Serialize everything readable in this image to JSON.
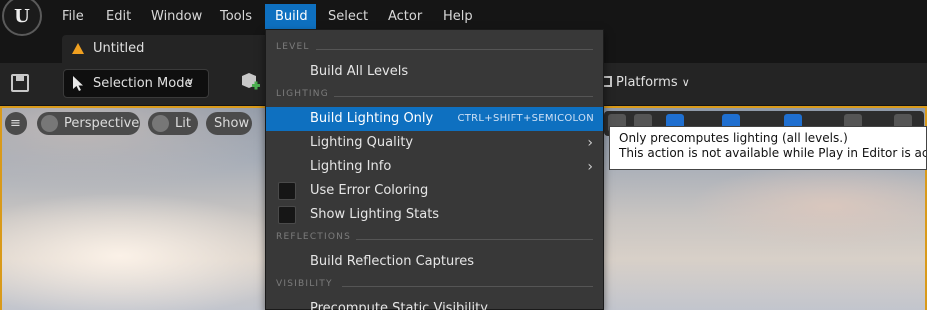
{
  "menubar": {
    "logo_text": "U",
    "items": [
      "File",
      "Edit",
      "Window",
      "Tools",
      "Build",
      "Select",
      "Actor",
      "Help"
    ],
    "active_item": "Build",
    "accent_color": "#0e70c0"
  },
  "tab": {
    "title": "Untitled",
    "icon": "unreal-warning-icon"
  },
  "toolbar": {
    "selection_mode_label": "Selection Mode",
    "platforms_label": "Platforms"
  },
  "viewport": {
    "menu_icon": "hamburger-icon",
    "perspective_label": "Perspective",
    "lit_label": "Lit",
    "show_label": "Show"
  },
  "build_menu": {
    "sections": {
      "level": "LEVEL",
      "lighting": "LIGHTING",
      "reflections": "REFLECTIONS",
      "visibility": "VISIBILITY"
    },
    "items": {
      "build_all_levels": "Build All Levels",
      "build_lighting_only": "Build Lighting Only",
      "build_lighting_only_shortcut": "CTRL+SHIFT+SEMICOLON",
      "lighting_quality": "Lighting Quality",
      "lighting_info": "Lighting Info",
      "use_error_coloring": "Use Error Coloring",
      "show_lighting_stats": "Show Lighting Stats",
      "build_reflection_captures": "Build Reflection Captures",
      "precompute_static_visibility": "Precompute Static Visibility"
    }
  },
  "tooltip": {
    "line1": "Only precomputes lighting (all levels.)",
    "line2": "This action is not available while Play in Editor is active, s"
  }
}
